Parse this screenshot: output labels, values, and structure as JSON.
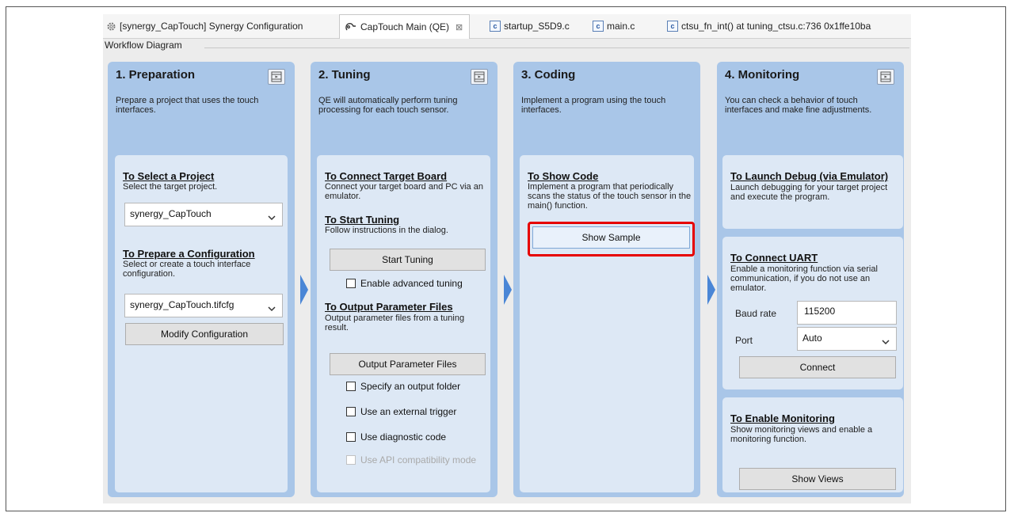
{
  "tabs": [
    {
      "label": "[synergy_CapTouch] Synergy Configuration",
      "icon": "gear-icon"
    },
    {
      "label": "CapTouch Main (QE)",
      "icon": "touch-icon",
      "close": "⊠"
    },
    {
      "label": "startup_S5D9.c",
      "icon": "c-file-icon"
    },
    {
      "label": "main.c",
      "icon": "c-file-icon"
    },
    {
      "label": "ctsu_fn_int() at tuning_ctsu.c:736 0x1ffe10ba",
      "icon": "c-file-icon"
    }
  ],
  "workflow_title": "Workflow Diagram",
  "columns": {
    "preparation": {
      "title": "1. Preparation",
      "desc": "Prepare a project that uses the touch interfaces.",
      "select_project": {
        "heading": "To Select a Project",
        "text": "Select the target project.",
        "value": "synergy_CapTouch"
      },
      "prepare_config": {
        "heading": "To Prepare a Configuration",
        "text": "Select or create a touch interface configuration.",
        "value": "synergy_CapTouch.tifcfg",
        "button": "Modify Configuration"
      }
    },
    "tuning": {
      "title": "2. Tuning",
      "desc": "QE will automatically perform tuning processing for each touch sensor.",
      "connect": {
        "heading": "To Connect Target Board",
        "text": "Connect your target board and PC via an emulator."
      },
      "start": {
        "heading": "To Start Tuning",
        "text": "Follow instructions in the dialog.",
        "button": "Start Tuning",
        "checkbox": "Enable advanced tuning"
      },
      "output": {
        "heading": "To Output Parameter Files",
        "text": "Output parameter files from a tuning result.",
        "button": "Output Parameter Files",
        "checkboxes": [
          "Specify an output folder",
          "Use an external trigger",
          "Use diagnostic code",
          "Use API compatibility mode"
        ]
      }
    },
    "coding": {
      "title": "3. Coding",
      "desc": "Implement a program using the touch interfaces.",
      "show_code": {
        "heading": "To Show Code",
        "text": "Implement a program that periodically scans the status of the touch sensor in the main() function.",
        "button": "Show Sample"
      }
    },
    "monitoring": {
      "title": "4. Monitoring",
      "desc": "You can check a behavior of touch interfaces and make fine adjustments.",
      "debug": {
        "heading": "To Launch Debug (via Emulator)",
        "text": "Launch debugging for your target project and execute the program."
      },
      "uart": {
        "heading": "To Connect UART",
        "text": "Enable a monitoring function via serial communication, if you do not use an emulator.",
        "baud_label": "Baud rate",
        "baud_value": "115200",
        "port_label": "Port",
        "port_value": "Auto",
        "button": "Connect"
      },
      "enable": {
        "heading": "To Enable Monitoring",
        "text": "Show monitoring views and enable a monitoring function.",
        "button": "Show Views"
      }
    }
  },
  "colors": {
    "panel": "#a9c6e8",
    "box": "#dde8f5",
    "arrow": "#4a86d6",
    "highlight": "#e60000"
  }
}
